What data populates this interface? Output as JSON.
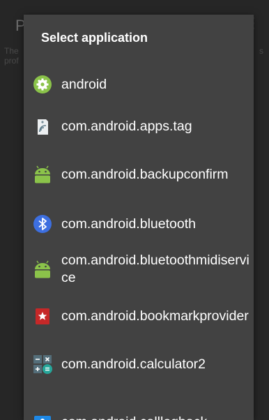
{
  "background": {
    "title": "P",
    "description_lines": [
      "The",
      "prof"
    ],
    "description_right": "s"
  },
  "dialog": {
    "title": "Select application",
    "items": [
      {
        "label": "android",
        "icon": "android-settings-gear-icon"
      },
      {
        "label": "com.android.apps.tag",
        "icon": "nfc-tag-icon"
      },
      {
        "label": "com.android.backupconfirm",
        "icon": "android-robot-icon"
      },
      {
        "label": "com.android.bluetooth",
        "icon": "bluetooth-icon"
      },
      {
        "label": "com.android.bluetoothmidiservice",
        "icon": "android-robot-icon"
      },
      {
        "label": "com.android.bookmarkprovider",
        "icon": "bookmark-icon"
      },
      {
        "label": "com.android.calculator2",
        "icon": "calculator-icon"
      },
      {
        "label": "com.android.calllogback",
        "icon": "contact-card-icon"
      }
    ]
  },
  "colors": {
    "dialog_bg": "#424242",
    "android_green": "#8bc34a",
    "bluetooth_blue": "#3d6fe0",
    "bookmark_red": "#c62828",
    "calculator_teal": "#26a69a"
  }
}
